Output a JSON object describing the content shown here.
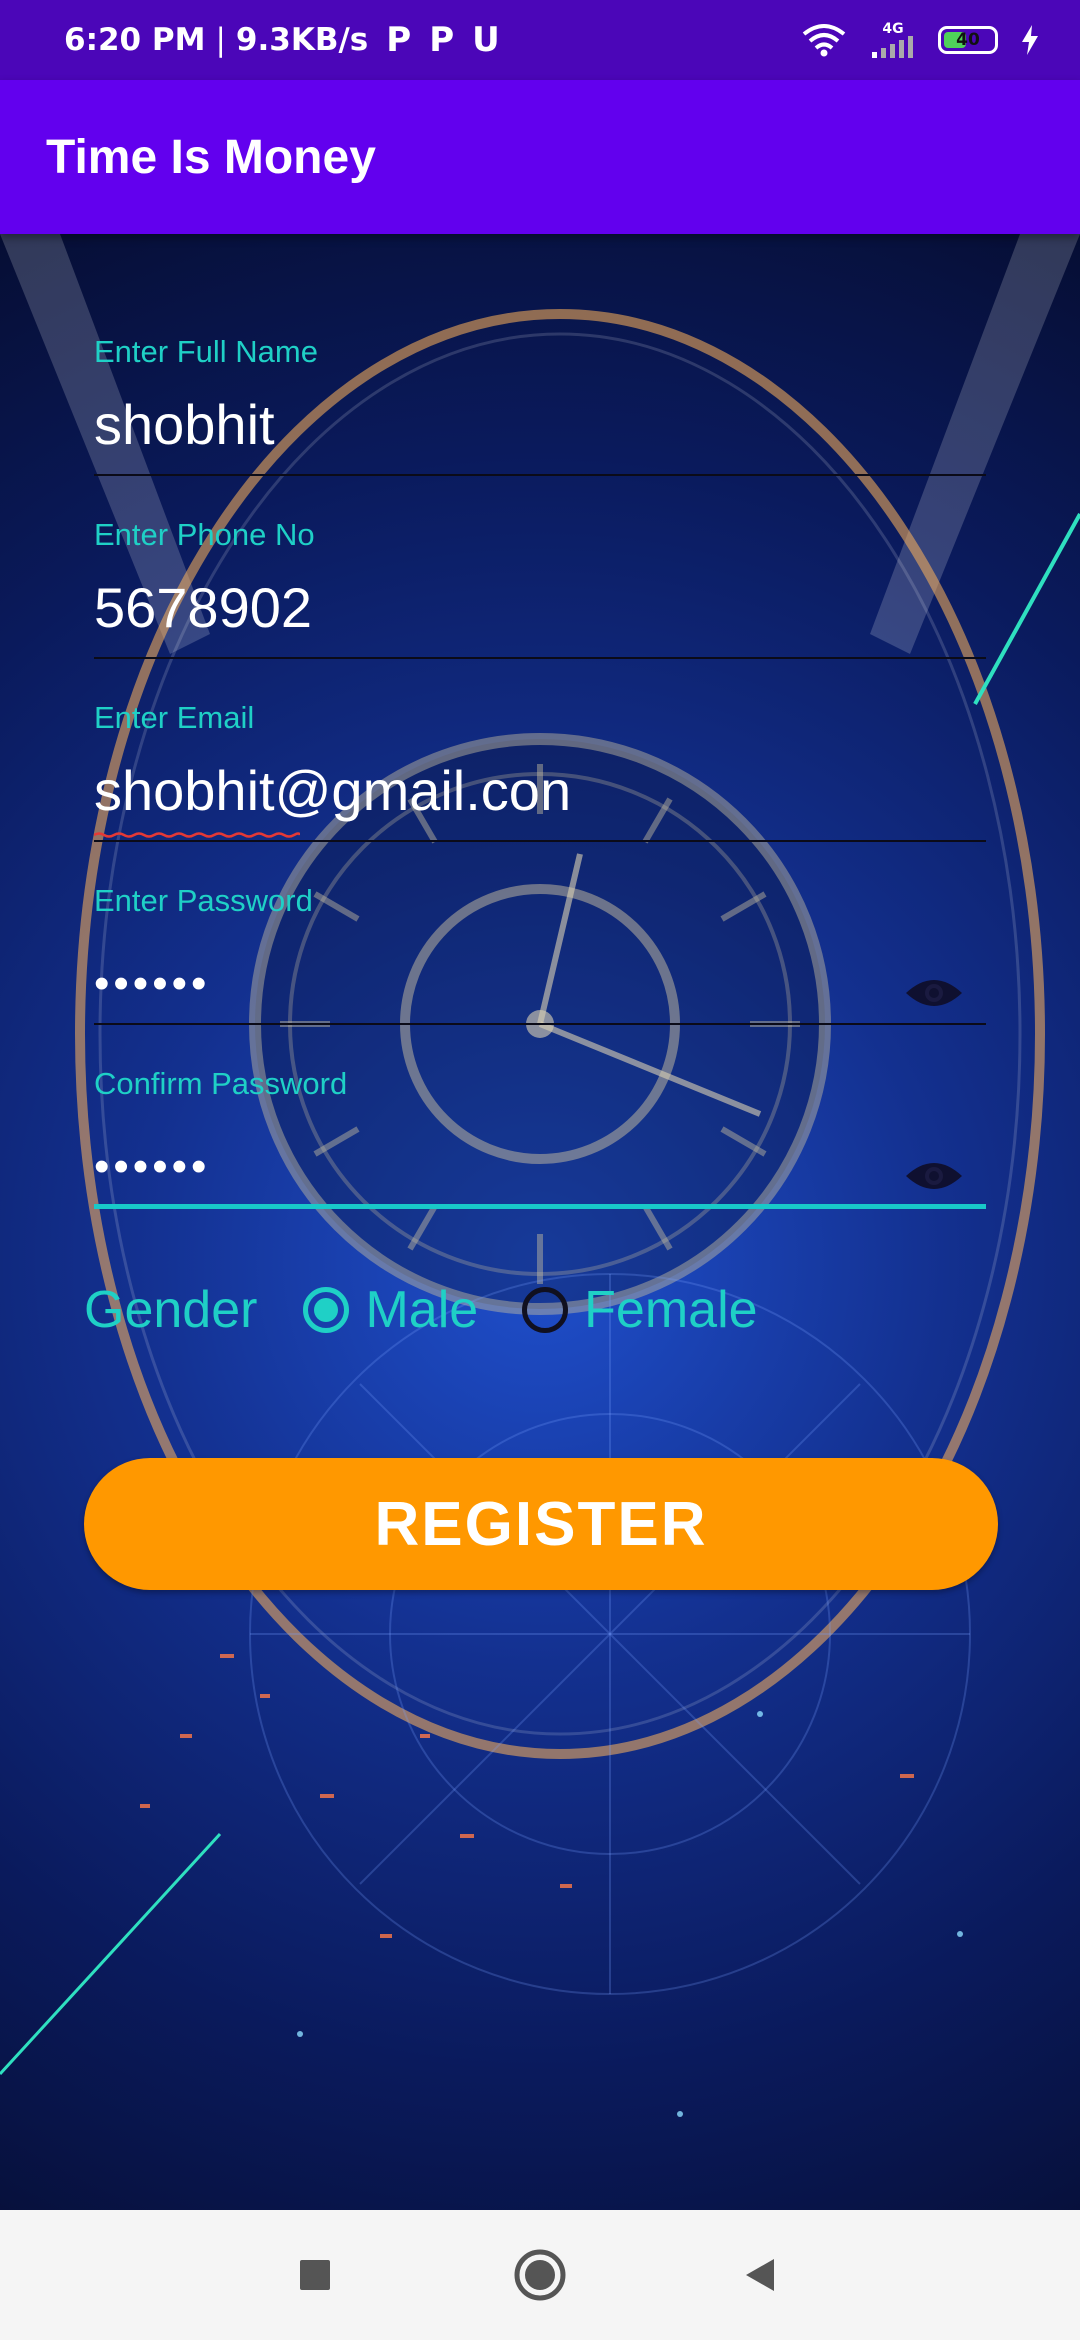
{
  "status_bar": {
    "time": "6:20 PM",
    "separator": "|",
    "speed": "9.3KB/s",
    "notification_icons": [
      "P",
      "P",
      "U"
    ],
    "network": "4G",
    "battery_level": "40",
    "icons": [
      "wifi-icon",
      "signal-icon",
      "battery-icon",
      "charging-icon"
    ]
  },
  "app_bar": {
    "title": "Time Is Money"
  },
  "form": {
    "full_name": {
      "label": "Enter Full Name",
      "value": "shobhit"
    },
    "phone": {
      "label": "Enter Phone No",
      "value": "5678902"
    },
    "email": {
      "label": "Enter Email",
      "value": "shobhit@gmail.con"
    },
    "password": {
      "label": "Enter Password",
      "value": "••••••"
    },
    "confirm_password": {
      "label": "Confirm Password",
      "value": "••••••"
    }
  },
  "gender": {
    "label": "Gender",
    "options": [
      {
        "label": "Male",
        "checked": true
      },
      {
        "label": "Female",
        "checked": false
      }
    ]
  },
  "register_button": {
    "label": "REGISTER"
  },
  "colors": {
    "status_bar": "#4b06b8",
    "app_bar": "#6200ee",
    "accent": "#1fd0c6",
    "button": "#ff9800"
  },
  "nav_bar": {
    "icons": [
      "recent-apps-icon",
      "home-icon",
      "back-icon"
    ]
  }
}
